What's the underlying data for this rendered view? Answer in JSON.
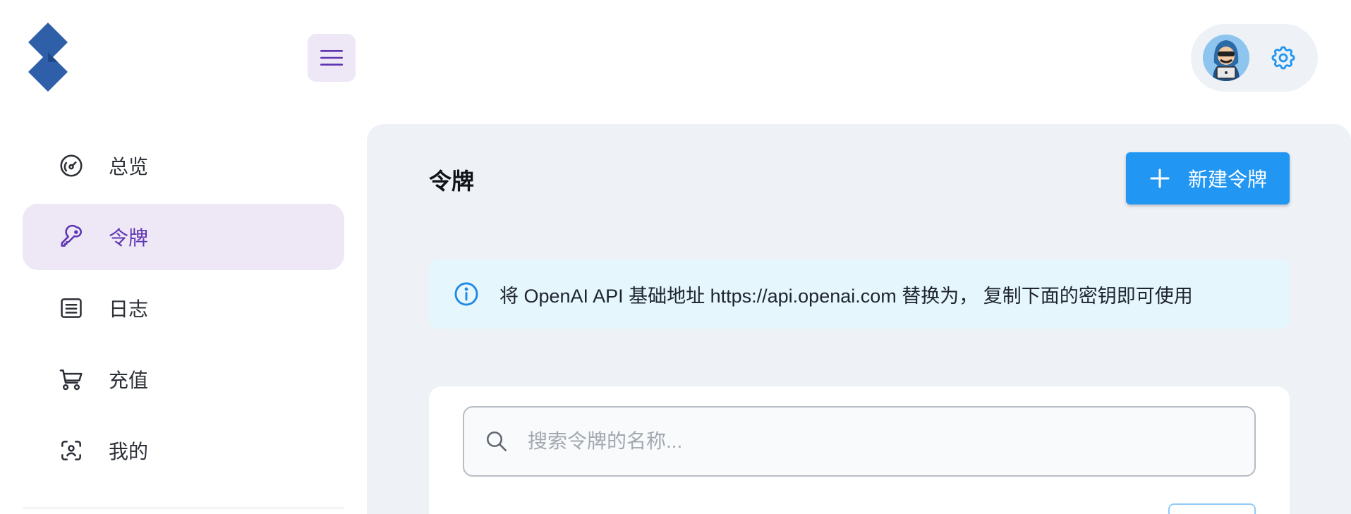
{
  "header": {
    "logo_icon": "app-logo",
    "menu_icon": "hamburger-icon",
    "avatar_icon": "hacker-avatar",
    "settings_icon": "gear-icon"
  },
  "sidebar": {
    "items": [
      {
        "label": "总览",
        "icon": "dashboard-gauge-icon",
        "active": false
      },
      {
        "label": "令牌",
        "icon": "key-icon",
        "active": true
      },
      {
        "label": "日志",
        "icon": "list-icon",
        "active": false
      },
      {
        "label": "充值",
        "icon": "cart-icon",
        "active": false
      },
      {
        "label": "我的",
        "icon": "face-scan-icon",
        "active": false
      }
    ]
  },
  "main": {
    "title": "令牌",
    "new_button_label": "新建令牌",
    "info_text": "将 OpenAI API 基础地址 https://api.openai.com 替换为， 复制下面的密钥即可使用",
    "search_placeholder": "搜索令牌的名称..."
  },
  "colors": {
    "accent": "#5e35b1",
    "active_bg": "#ede7f6",
    "primary_button": "#2196f3",
    "info_bg": "#e5f6fd",
    "info_icon": "#1e88e5",
    "main_bg": "#eef1f6"
  }
}
